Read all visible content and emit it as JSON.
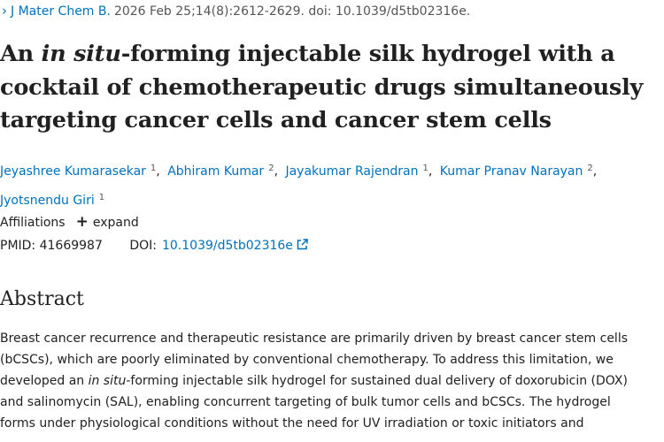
{
  "citation": {
    "chevron": "›",
    "journal": "J Mater Chem B.",
    "details": "2026 Feb 25;14(8):2612-2629. doi: 10.1039/d5tb02316e."
  },
  "title": {
    "part1": "An ",
    "italic": "in situ",
    "part2": "-forming injectable silk hydrogel with a cocktail of chemotherapeutic drugs simultaneously targeting cancer cells and cancer stem cells"
  },
  "authors": [
    {
      "name": "Jeyashree Kumarasekar",
      "aff": "1"
    },
    {
      "name": "Abhiram Kumar",
      "aff": "2"
    },
    {
      "name": "Jayakumar Rajendran",
      "aff": "1"
    },
    {
      "name": "Kumar Pranav Narayan",
      "aff": "2"
    },
    {
      "name": "Jyotsnendu Giri",
      "aff": "1"
    }
  ],
  "affiliations": {
    "label": "Affiliations",
    "expand_label": "expand"
  },
  "ids": {
    "pmid_label": "PMID:",
    "pmid": "41669987",
    "doi_label": "DOI:",
    "doi": "10.1039/d5tb02316e"
  },
  "abstract": {
    "heading": "Abstract",
    "line1": "Breast cancer recurrence and therapeutic resistance are primarily driven by breast cancer stem cells",
    "line2": "(bCSCs), which are poorly eliminated by conventional chemotherapy. To address this limitation, we",
    "line3_pre": "developed an ",
    "line3_ital": "in situ",
    "line3_post": "-forming injectable silk hydrogel for sustained dual delivery of doxorubicin (DOX)",
    "line4": "and salinomycin (SAL), enabling concurrent targeting of bulk tumor cells and bCSCs. The hydrogel",
    "line5": "forms under physiological conditions without the need for UV irradiation or toxic initiators and"
  },
  "colors": {
    "link": "#0071bc",
    "text": "#212121",
    "muted": "#555555"
  }
}
